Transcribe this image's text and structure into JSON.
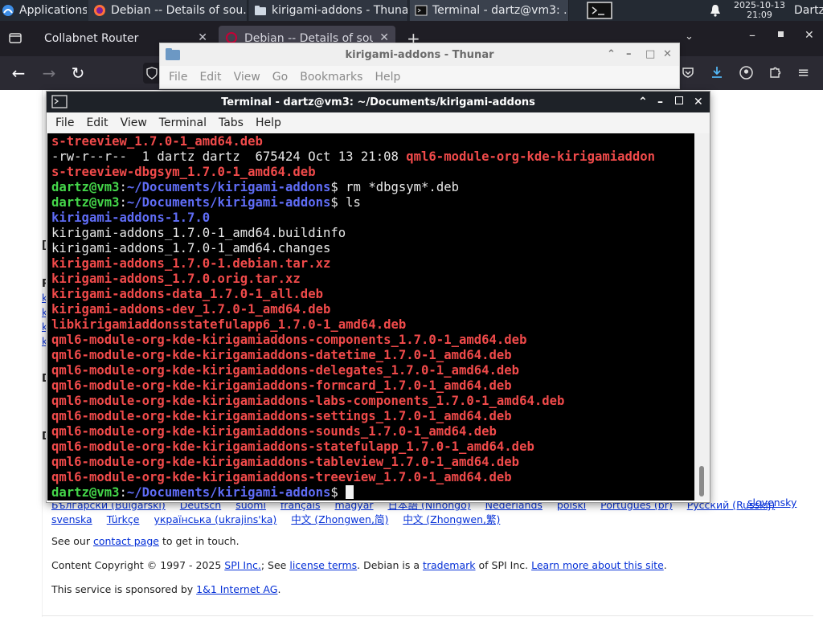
{
  "panel": {
    "applications_label": "Applications",
    "tasks": [
      {
        "label": "Debian -- Details of sou..."
      },
      {
        "label": "kirigami-addons - Thunar"
      },
      {
        "label": "Terminal - dartz@vm3: ..."
      }
    ],
    "clock_date": "2025-10-13",
    "clock_time": "21:09",
    "user_label": "Dartz"
  },
  "firefox": {
    "tabs": [
      {
        "label": "Collabnet Router"
      },
      {
        "label": "Debian -- Details of sou"
      }
    ],
    "footer": {
      "language_links_row1": [
        "Български (Bulgarski)",
        "Deutsch",
        "suomi",
        "français",
        "magyar",
        "日本語 (Nihongo)",
        "Nederlands",
        "polski",
        "Português (br)",
        "Русский (Russkij)",
        "slovensky"
      ],
      "language_links_row2": [
        "svenska",
        "Türkçe",
        "українська (ukrajins'ka)",
        "中文 (Zhongwen,简)",
        "中文 (Zhongwen,繁)"
      ],
      "contact_prefix": "See our ",
      "contact_link": "contact page",
      "contact_suffix": " to get in touch.",
      "copyright_prefix": "Content Copyright © 1997 - 2025 ",
      "spi_link": "SPI Inc.",
      "copyright_mid1": "; See ",
      "license_link": "license terms",
      "copyright_mid2": ". Debian is a ",
      "trademark_link": "trademark",
      "copyright_mid3": " of SPI Inc. ",
      "learn_link": "Learn more about this site",
      "copyright_end": ".",
      "sponsor_prefix": "This service is sponsored by ",
      "sponsor_link": "1&1 Internet AG",
      "sponsor_end": "."
    }
  },
  "thunar": {
    "title": "kirigami-addons - Thunar",
    "menu": [
      "File",
      "Edit",
      "View",
      "Go",
      "Bookmarks",
      "Help"
    ]
  },
  "terminal": {
    "title": "Terminal - dartz@vm3: ~/Documents/kirigami-addons",
    "menu": [
      "File",
      "Edit",
      "View",
      "Terminal",
      "Tabs",
      "Help"
    ],
    "prompt_user": "dartz@vm3",
    "prompt_path": "~/Documents/kirigami-addons",
    "lines": [
      {
        "kind": "red",
        "text": "s-treeview_1.7.0-1_amd64.deb"
      },
      {
        "kind": "lsl",
        "meta": "-rw-r--r--  1 dartz dartz  675424 Oct 13 21:08 ",
        "file": "qml6-module-org-kde-kirigamiaddon"
      },
      {
        "kind": "red",
        "text": "s-treeview-dbgsym_1.7.0-1_amd64.deb"
      },
      {
        "kind": "prompt",
        "cmd": " rm *dbgsym*.deb"
      },
      {
        "kind": "prompt",
        "cmd": " ls"
      },
      {
        "kind": "blue",
        "text": "kirigami-addons-1.7.0"
      },
      {
        "kind": "white",
        "text": "kirigami-addons_1.7.0-1_amd64.buildinfo"
      },
      {
        "kind": "white",
        "text": "kirigami-addons_1.7.0-1_amd64.changes"
      },
      {
        "kind": "red",
        "text": "kirigami-addons_1.7.0-1.debian.tar.xz"
      },
      {
        "kind": "red",
        "text": "kirigami-addons_1.7.0.orig.tar.xz"
      },
      {
        "kind": "red",
        "text": "kirigami-addons-data_1.7.0-1_all.deb"
      },
      {
        "kind": "red",
        "text": "kirigami-addons-dev_1.7.0-1_amd64.deb"
      },
      {
        "kind": "red",
        "text": "libkirigamiaddonsstatefulapp6_1.7.0-1_amd64.deb"
      },
      {
        "kind": "red",
        "text": "qml6-module-org-kde-kirigamiaddons-components_1.7.0-1_amd64.deb"
      },
      {
        "kind": "red",
        "text": "qml6-module-org-kde-kirigamiaddons-datetime_1.7.0-1_amd64.deb"
      },
      {
        "kind": "red",
        "text": "qml6-module-org-kde-kirigamiaddons-delegates_1.7.0-1_amd64.deb"
      },
      {
        "kind": "red",
        "text": "qml6-module-org-kde-kirigamiaddons-formcard_1.7.0-1_amd64.deb"
      },
      {
        "kind": "red",
        "text": "qml6-module-org-kde-kirigamiaddons-labs-components_1.7.0-1_amd64.deb"
      },
      {
        "kind": "red",
        "text": "qml6-module-org-kde-kirigamiaddons-settings_1.7.0-1_amd64.deb"
      },
      {
        "kind": "red",
        "text": "qml6-module-org-kde-kirigamiaddons-sounds_1.7.0-1_amd64.deb"
      },
      {
        "kind": "red",
        "text": "qml6-module-org-kde-kirigamiaddons-statefulapp_1.7.0-1_amd64.deb"
      },
      {
        "kind": "red",
        "text": "qml6-module-org-kde-kirigamiaddons-tableview_1.7.0-1_amd64.deb"
      },
      {
        "kind": "red",
        "text": "qml6-module-org-kde-kirigamiaddons-treeview_1.7.0-1_amd64.deb"
      },
      {
        "kind": "prompt_cursor",
        "cmd": " "
      }
    ]
  },
  "colors": {
    "panel_bg": "#242a33",
    "terminal_bg": "#000000",
    "file_red": "#f04a4a",
    "dir_blue": "#5f6cf5",
    "prompt_green": "#44d64a",
    "link_blue": "#0530d7"
  }
}
